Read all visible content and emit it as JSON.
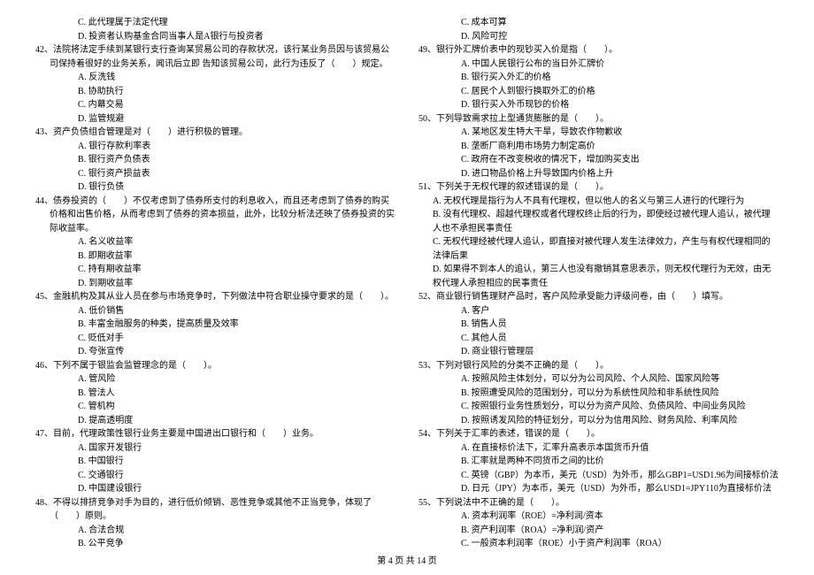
{
  "left": {
    "q41_c": "C. 此代理属于法定代理",
    "q41_d": "D. 投资者认购基金合同当事人是A银行与投资者",
    "q42": "42、法院将法定手续到某银行支行查询某贸易公司的存款状况，该行某业务员因与该贸易公司保持着很好的业务关系，闻讯后立即  告知该贸易公司，此行为违反了（　　）规定。",
    "q42_a": "A. 反洗钱",
    "q42_b": "B. 协助执行",
    "q42_c": "C. 内幕交易",
    "q42_d": "D. 监管规避",
    "q43": "43、资产负债组合管理是对（　　）进行积极的管理。",
    "q43_a": "A. 银行存款利率表",
    "q43_b": "B. 银行资产负债表",
    "q43_c": "C. 银行资产损益表",
    "q43_d": "D. 银行负债",
    "q44": "44、债券投资的（　　）不仅考虑到了债券所支付的利息收入，而且还考虑到了债券的购买价格和出售价格，从而考虑到了债券的资本损益，此外，比较分析法还映了债券投资的实际收益率。",
    "q44_a": "A. 名义收益率",
    "q44_b": "B. 即期收益率",
    "q44_c": "C. 持有期收益率",
    "q44_d": "D. 到期收益率",
    "q45": "45、金融机构及其从业人员在参与市场竞争时，下列做法中符合职业操守要求的是（　　）。",
    "q45_a": "A. 低价销售",
    "q45_b": "B. 丰富金融服务的种类，提高质量及效率",
    "q45_c": "C. 贬低对手",
    "q45_d": "D. 夸张宣传",
    "q46": "46、下列不属于银监会监管理念的是（　　）。",
    "q46_a": "A. 管风险",
    "q46_b": "B. 管法人",
    "q46_c": "C. 管机构",
    "q46_d": "D. 提高透明度",
    "q47": "47、目前，代理政策性银行业务主要是中国进出口银行和（　　）业务。",
    "q47_a": "A. 国家开发银行",
    "q47_b": "B. 中国银行",
    "q47_c": "C. 交通银行",
    "q47_d": "D. 中国建设银行",
    "q48": "48、不得以排挤竞争对手为目的，进行低价倾销、恶性竞争或其他不正当竞争，体现了（　　）原则。",
    "q48_a": "A. 合法合规",
    "q48_b": "B. 公平竞争"
  },
  "right": {
    "q48_c": "C. 成本可算",
    "q48_d": "D. 风险可控",
    "q49": "49、银行外汇牌价表中的现钞买入价是指（　　）。",
    "q49_a": "A. 中国人民银行公布的当日外汇牌价",
    "q49_b": "B. 银行买入外汇的价格",
    "q49_c": "C. 居民个人到银行换取外汇的价格",
    "q49_d": "D. 银行买入外币现钞的价格",
    "q50": "50、下列导致需求拉上型通货膨胀的是（　　）。",
    "q50_a": "A. 某地区发生特大干旱，导致农作物歉收",
    "q50_b": "B. 垄断厂商利用市场势力制定高价",
    "q50_c": "C. 政府在不改变税收的情况下，增加购买支出",
    "q50_d": "D. 进口物品价格上升导致国内价格上升",
    "q51": "51、下列关于无权代理的叙述错误的是（　　）。",
    "q51_a": "A. 无权代理是指行为人不具有代理权，但以他人的名义与第三人进行的代理行为",
    "q51_b": "B. 没有代理权、超越代理权或者代理权终止后的行为，即使经过被代理人追认，被代理人也不承担民事责任",
    "q51_c": "C. 无权代理经被代理人追认，即直接对被代理人发生法律效力，产生与有权代理相同的法律后果",
    "q51_d": "D. 如果得不到本人的追认，第三人也没有撤销其意思表示，则无权代理行为无效，由无权代理人承担相应的民事责任",
    "q52": "52、商业银行销售理财产品时，客户风险承受能力评级问卷，由（　　）填写。",
    "q52_a": "A. 客户",
    "q52_b": "B. 销售人员",
    "q52_c": "C. 其他人员",
    "q52_d": "D. 商业银行管理层",
    "q53": "53、下列对银行风险的分类不正确的是（　　）。",
    "q53_a": "A. 按照风险主体划分，可以分为公司风险、个人风险、国家风险等",
    "q53_b": "B. 按照遭受风险的范围划分，可以分为系统性风险和非系统性风险",
    "q53_c": "C. 按照银行业务性质划分，可以分为资产风险、负债风险、中间业务风险",
    "q53_d": "D. 按照诱发风险的特征划分，可以分为信用风险、财务风险、利率风险",
    "q54": "54、下列关于汇率的表述，错误的是（　　）。",
    "q54_a": "A. 在直接标价法下，汇率升高表示本国货币升值",
    "q54_b": "B. 汇率就是两种不同货币之间的比价",
    "q54_c": "C. 英镑（GBP）为本币，美元（USD）为外币，那么GBP1=USD1.96为间接标价法",
    "q54_d": "D. 日元（JPY）为本币，美元（USD）为外币，那么USD1=JPY110为直接标价法",
    "q55": "55、下列说法中不正确的是（　　）。",
    "q55_a": "A. 资本利润率（ROE）=净利润/资本",
    "q55_b": "B. 资产利润率（ROA）=净利润/资产",
    "q55_c": "C. 一般资本利润率（ROE）小于资产利润率（ROA）"
  },
  "footer": "第 4 页 共 14 页"
}
